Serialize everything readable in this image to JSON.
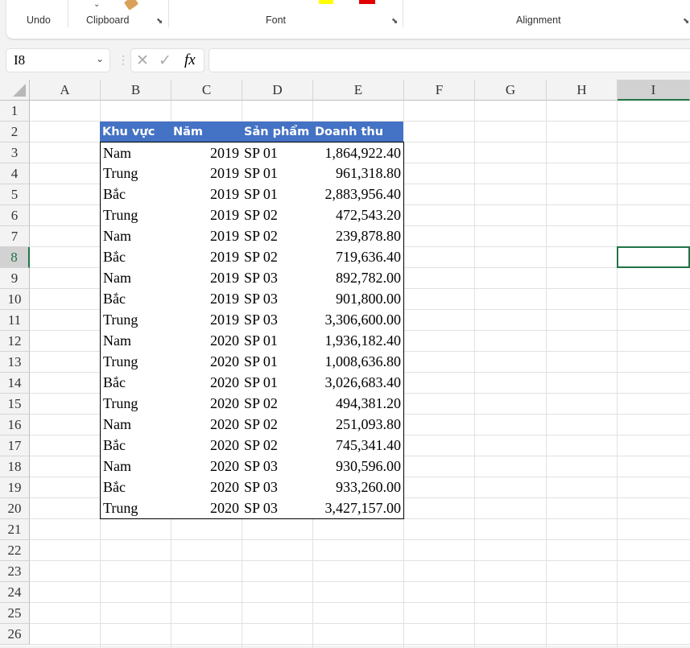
{
  "ribbon": {
    "groups": [
      "Undo",
      "Clipboard",
      "Font",
      "Alignment"
    ]
  },
  "name_box": "I8",
  "formula_bar": {
    "cancel": "✕",
    "enter": "✓",
    "fx": "fx",
    "value": ""
  },
  "columns": [
    "A",
    "B",
    "C",
    "D",
    "E",
    "F",
    "G",
    "H",
    "I"
  ],
  "selected_cell": "I8",
  "table": {
    "headers": [
      "Khu vực",
      "Năm",
      "Sản phẩm",
      "Doanh thu"
    ],
    "rows": [
      [
        "Nam",
        "2019",
        "SP 01",
        "1,864,922.40"
      ],
      [
        "Trung",
        "2019",
        "SP 01",
        "961,318.80"
      ],
      [
        "Bắc",
        "2019",
        "SP 01",
        "2,883,956.40"
      ],
      [
        "Trung",
        "2019",
        "SP 02",
        "472,543.20"
      ],
      [
        "Nam",
        "2019",
        "SP 02",
        "239,878.80"
      ],
      [
        "Bắc",
        "2019",
        "SP 02",
        "719,636.40"
      ],
      [
        "Nam",
        "2019",
        "SP 03",
        "892,782.00"
      ],
      [
        "Bắc",
        "2019",
        "SP 03",
        "901,800.00"
      ],
      [
        "Trung",
        "2019",
        "SP 03",
        "3,306,600.00"
      ],
      [
        "Nam",
        "2020",
        "SP 01",
        "1,936,182.40"
      ],
      [
        "Trung",
        "2020",
        "SP 01",
        "1,008,636.80"
      ],
      [
        "Bắc",
        "2020",
        "SP 01",
        "3,026,683.40"
      ],
      [
        "Trung",
        "2020",
        "SP 02",
        "494,381.20"
      ],
      [
        "Nam",
        "2020",
        "SP 02",
        "251,093.80"
      ],
      [
        "Bắc",
        "2020",
        "SP 02",
        "745,341.40"
      ],
      [
        "Nam",
        "2020",
        "SP 03",
        "930,596.00"
      ],
      [
        "Bắc",
        "2020",
        "SP 03",
        "933,260.00"
      ],
      [
        "Trung",
        "2020",
        "SP 03",
        "3,427,157.00"
      ]
    ]
  },
  "colors": {
    "header": "#4472c4",
    "accent": "#217346"
  }
}
